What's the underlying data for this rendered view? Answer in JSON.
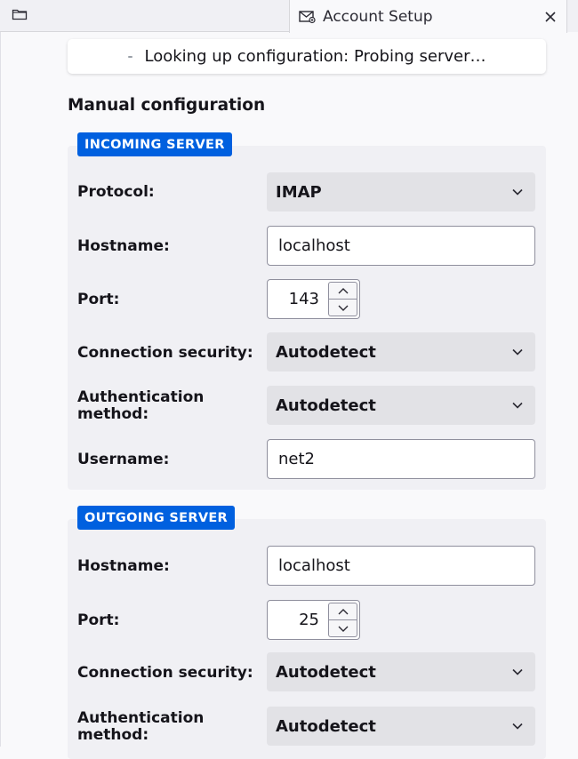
{
  "tab": {
    "title": "Account Setup",
    "folder_icon": "folder-icon",
    "tab_icon": "mail-setup-icon",
    "close_icon": "close-icon"
  },
  "notice": {
    "text": "Looking up configuration: Probing server…"
  },
  "section_title": "Manual configuration",
  "incoming": {
    "label": "INCOMING SERVER",
    "protocol_label": "Protocol:",
    "protocol_value": "IMAP",
    "hostname_label": "Hostname:",
    "hostname_value": "localhost",
    "port_label": "Port:",
    "port_value": "143",
    "security_label": "Connection security:",
    "security_value": "Autodetect",
    "auth_label_line1": "Authentication",
    "auth_label_line2": "method:",
    "auth_value": "Autodetect",
    "username_label": "Username:",
    "username_value": "net2"
  },
  "outgoing": {
    "label": "OUTGOING SERVER",
    "hostname_label": "Hostname:",
    "hostname_value": "localhost",
    "port_label": "Port:",
    "port_value": "25",
    "security_label": "Connection security:",
    "security_value": "Autodetect",
    "auth_label_line1": "Authentication",
    "auth_label_line2": "method:",
    "auth_value": "Autodetect"
  },
  "colors": {
    "accent": "#0060df",
    "group_bg": "#f0f0f4",
    "select_bg": "#e2e2e6"
  }
}
